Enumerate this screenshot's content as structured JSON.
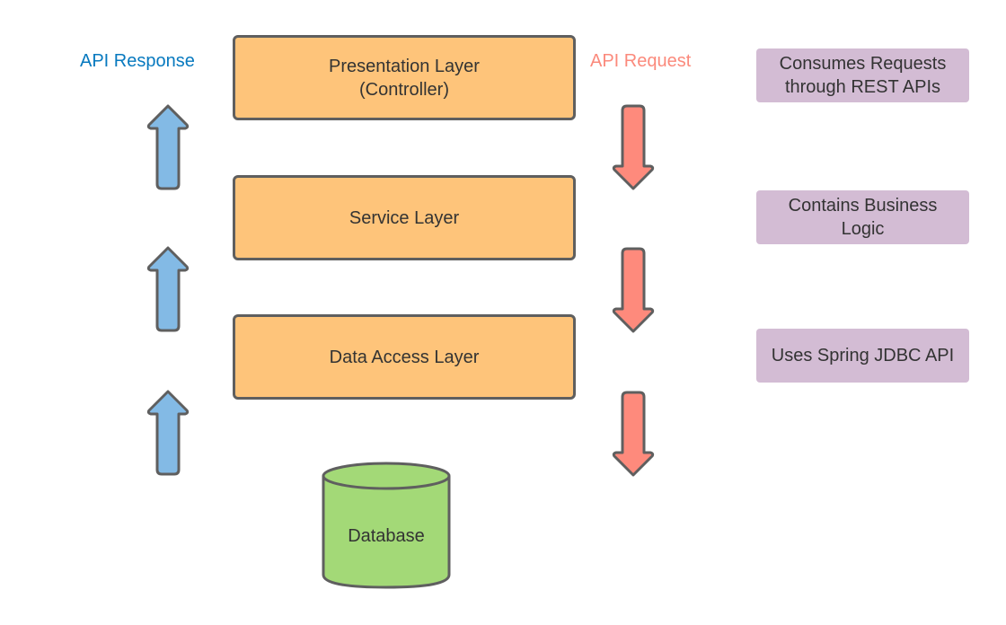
{
  "labels": {
    "response": "API Response",
    "request": "API Request"
  },
  "colors": {
    "response": "#0779bf",
    "request": "#fb8a7c",
    "layer_fill": "#fec47a",
    "note_fill": "#d3bcd4",
    "db_fill": "#a3d977",
    "up_arrow_fill": "#83bae5",
    "down_arrow_fill": "#fe8a7c",
    "stroke": "#5f5f5f"
  },
  "layers": [
    {
      "label": "Presentation Layer\n(Controller)"
    },
    {
      "label": "Service Layer"
    },
    {
      "label": "Data Access Layer"
    }
  ],
  "notes": [
    {
      "label": "Consumes Requests\nthrough REST APIs"
    },
    {
      "label": "Contains Business\nLogic"
    },
    {
      "label": "Uses Spring JDBC API"
    }
  ],
  "database": {
    "label": "Database"
  },
  "arrows": {
    "up": [
      {
        "direction": "up"
      },
      {
        "direction": "up"
      },
      {
        "direction": "up"
      }
    ],
    "down": [
      {
        "direction": "down"
      },
      {
        "direction": "down"
      },
      {
        "direction": "down"
      }
    ]
  }
}
